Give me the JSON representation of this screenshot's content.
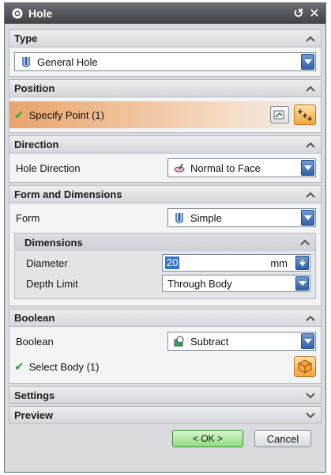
{
  "window": {
    "title": "Hole"
  },
  "type_group": {
    "header": "Type",
    "selected": "General Hole"
  },
  "position_group": {
    "header": "Position",
    "specify_point": "Specify Point (1)"
  },
  "direction_group": {
    "header": "Direction",
    "label": "Hole Direction",
    "selected": "Normal to Face"
  },
  "form_group": {
    "header": "Form and Dimensions",
    "form_label": "Form",
    "form_selected": "Simple",
    "dimensions": {
      "header": "Dimensions",
      "diameter_label": "Diameter",
      "diameter_value": "20",
      "diameter_unit": "mm",
      "depth_label": "Depth Limit",
      "depth_selected": "Through Body"
    }
  },
  "boolean_group": {
    "header": "Boolean",
    "label": "Boolean",
    "selected": "Subtract",
    "select_body": "Select Body (1)"
  },
  "settings_group": {
    "header": "Settings"
  },
  "preview_group": {
    "header": "Preview"
  },
  "footer": {
    "ok": "< OK >",
    "cancel": "Cancel"
  },
  "colors": {
    "accent_orange": "#f5a53d",
    "ok_green": "#8fdc7e",
    "combo_blue": "#2f62a8",
    "check_green": "#3aa33a"
  }
}
